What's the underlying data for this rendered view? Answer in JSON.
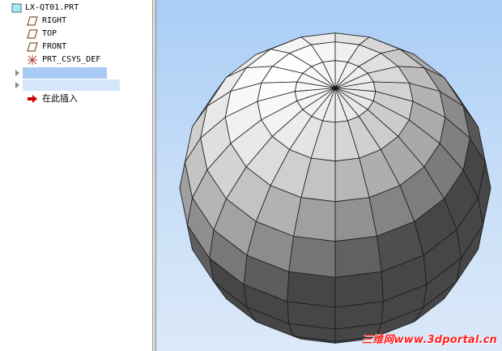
{
  "tree": {
    "root_label": "LX-QT01.PRT",
    "items": [
      {
        "label": "RIGHT",
        "icon": "datum-plane-icon"
      },
      {
        "label": "TOP",
        "icon": "datum-plane-icon"
      },
      {
        "label": "FRONT",
        "icon": "datum-plane-icon"
      },
      {
        "label": "PRT_CSYS_DEF",
        "icon": "csys-icon"
      }
    ],
    "insert_here_label": "在此插入"
  },
  "viewport": {
    "model": "faceted-sphere"
  },
  "watermark": "三维网www.3dportal.cn",
  "colors": {
    "selection": "#a9cbf3",
    "insert_arrow": "#cc0000",
    "background_top": "#a9cdf6",
    "background_bottom": "#dbe9f8"
  }
}
